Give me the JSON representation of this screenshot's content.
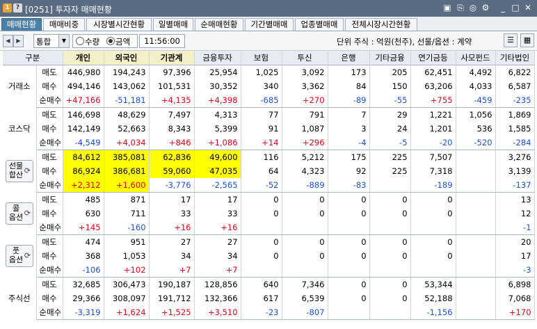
{
  "window": {
    "icon1": "1",
    "icon2": "?",
    "title": "[0251] 투자자 매매현황"
  },
  "tabs": [
    "매매현황",
    "매매비중",
    "시장별시간현황",
    "일별매매",
    "순매매현황",
    "기간별매매",
    "업종별매매",
    "전체시장시간현황"
  ],
  "toolbar": {
    "market": "통합",
    "radio_qty": "수량",
    "radio_amt": "금액",
    "time": "11:56:00",
    "unit_text": "단위 주식 : 억원(천주), 선물/옵션 : 계약"
  },
  "columns": [
    "구분",
    "개인",
    "외국인",
    "기관계",
    "금융투자",
    "보험",
    "투신",
    "은행",
    "기타금융",
    "연기금등",
    "사모펀드",
    "기타법인"
  ],
  "row_labels": {
    "sell": "매도",
    "buy": "매수",
    "net": "순매수"
  },
  "groups": [
    {
      "name": "거래소",
      "button": false,
      "sell": [
        "446,980",
        "194,243",
        "97,396",
        "25,954",
        "1,025",
        "3,092",
        "173",
        "205",
        "62,451",
        "4,492",
        "6,822"
      ],
      "buy": [
        "494,146",
        "143,062",
        "101,531",
        "30,352",
        "340",
        "3,362",
        "84",
        "150",
        "63,206",
        "4,033",
        "6,587"
      ],
      "net": [
        "+47,166",
        "-51,181",
        "+4,135",
        "+4,398",
        "-685",
        "+270",
        "-89",
        "-55",
        "+755",
        "-459",
        "-235"
      ]
    },
    {
      "name": "코스닥",
      "button": false,
      "sell": [
        "146,698",
        "48,629",
        "7,497",
        "4,313",
        "77",
        "791",
        "7",
        "29",
        "1,221",
        "1,056",
        "1,869"
      ],
      "buy": [
        "142,149",
        "52,663",
        "8,343",
        "5,399",
        "91",
        "1,087",
        "3",
        "24",
        "1,201",
        "536",
        "1,585"
      ],
      "net": [
        "-4,549",
        "+4,034",
        "+846",
        "+1,086",
        "+14",
        "+296",
        "-4",
        "-5",
        "-20",
        "-520",
        "-284"
      ]
    },
    {
      "name": "선물\n합산",
      "button": true,
      "sell": [
        "84,612",
        "385,081",
        "62,836",
        "49,600",
        "116",
        "5,212",
        "175",
        "225",
        "7,507",
        "",
        "3,276"
      ],
      "buy": [
        "86,924",
        "386,681",
        "59,060",
        "47,035",
        "64",
        "4,323",
        "92",
        "225",
        "7,318",
        "",
        "3,139"
      ],
      "net": [
        "+2,312",
        "+1,600",
        "-3,776",
        "-2,565",
        "-52",
        "-889",
        "-83",
        "",
        "-189",
        "",
        "-137"
      ]
    },
    {
      "name": "콜\n옵션",
      "button": true,
      "sell": [
        "485",
        "871",
        "17",
        "17",
        "0",
        "0",
        "0",
        "0",
        "0",
        "",
        "13"
      ],
      "buy": [
        "630",
        "711",
        "33",
        "33",
        "0",
        "0",
        "0",
        "0",
        "0",
        "",
        "12"
      ],
      "net": [
        "+145",
        "-160",
        "+16",
        "+16",
        "",
        "",
        "",
        "",
        "",
        "",
        "-1"
      ]
    },
    {
      "name": "풋\n옵션",
      "button": true,
      "sell": [
        "474",
        "951",
        "27",
        "27",
        "0",
        "0",
        "0",
        "0",
        "0",
        "",
        "20"
      ],
      "buy": [
        "368",
        "1,053",
        "34",
        "34",
        "0",
        "0",
        "0",
        "0",
        "0",
        "",
        "17"
      ],
      "net": [
        "-106",
        "+102",
        "+7",
        "+7",
        "",
        "",
        "",
        "",
        "",
        "",
        "-3"
      ]
    },
    {
      "name": "주식선",
      "button": false,
      "sell": [
        "32,685",
        "306,473",
        "190,187",
        "128,856",
        "640",
        "7,346",
        "0",
        "0",
        "53,344",
        "",
        "6,898"
      ],
      "buy": [
        "29,366",
        "308,097",
        "191,712",
        "132,366",
        "617",
        "6,539",
        "0",
        "0",
        "52,188",
        "",
        "7,068"
      ],
      "net": [
        "-3,319",
        "+1,624",
        "+1,525",
        "+3,510",
        "-23",
        "-807",
        "",
        "",
        "-1,156",
        "",
        "+170"
      ]
    }
  ],
  "colors": {
    "positive": "#e2001a",
    "negative": "#1b4fd6",
    "highlight": "#ffff00",
    "title_bg": "#5a6b82",
    "active_tab": "#4b7fa6"
  }
}
